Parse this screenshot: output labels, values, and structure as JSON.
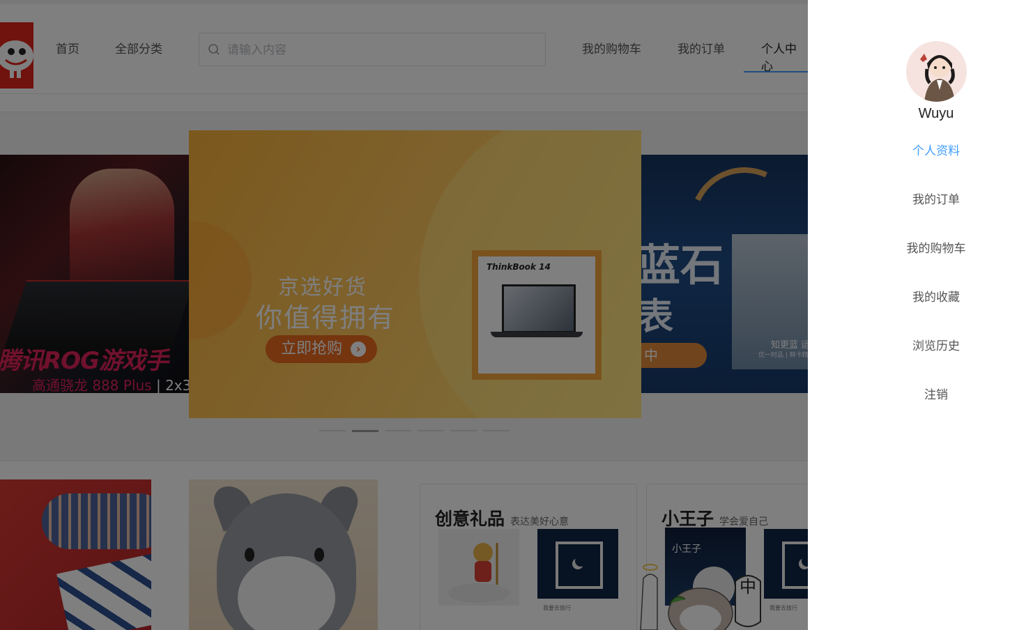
{
  "header": {
    "nav": [
      "首页",
      "全部分类"
    ],
    "search_placeholder": "请输入内容",
    "right_nav": [
      "我的购物车",
      "我的订单",
      "个人中心"
    ]
  },
  "carousel": {
    "left_slide": {
      "title": "腾讯ROG游戏手",
      "subtitle": "高通骁龙 888 Plus",
      "subtitle_tail": " | 2x3"
    },
    "center_slide": {
      "line1": "京选好货",
      "line2": "你值得拥有",
      "button": "立即抢购",
      "product_brand": "ThinkBook 14"
    },
    "right_slide": {
      "text1": "蓝石",
      "text2": "表",
      "button": "中",
      "photo_caption": "知更蓝 运",
      "photo_sub": "优一时品 | 鲜卡精致表壳"
    },
    "indicator_count": 6,
    "active_index": 1
  },
  "categories": [
    {
      "title": "创意礼品",
      "subtitle": "表达美好心意",
      "caption": "我要去旅行"
    },
    {
      "title": "小王子",
      "subtitle": "学会爱自己",
      "book_title": "小王子",
      "caption": "我要去旅行"
    }
  ],
  "mascot_badge": "中",
  "drawer": {
    "username": "Wuyu",
    "menu": [
      {
        "label": "个人资料",
        "active": true
      },
      {
        "label": "我的订单",
        "active": false
      },
      {
        "label": "我的购物车",
        "active": false
      },
      {
        "label": "我的收藏",
        "active": false
      },
      {
        "label": "浏览历史",
        "active": false
      },
      {
        "label": "注销",
        "active": false
      }
    ],
    "accent_color": "#409eff"
  }
}
